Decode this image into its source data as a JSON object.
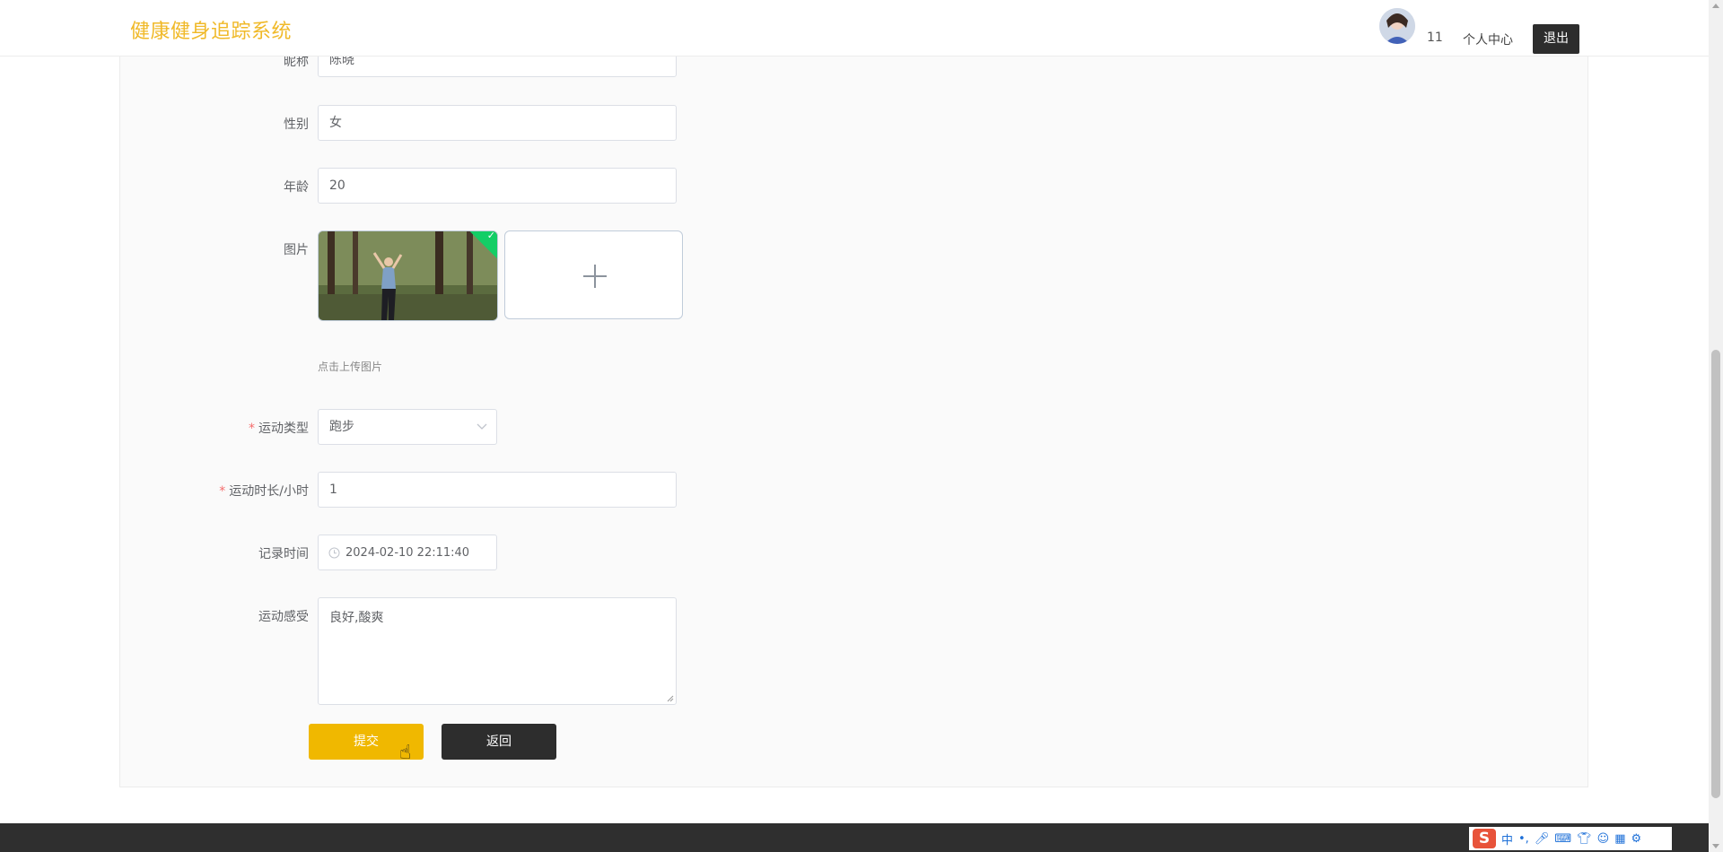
{
  "header": {
    "brand": "健康健身追踪系统",
    "username": "11",
    "personal_center": "个人中心",
    "logout": "退出"
  },
  "form": {
    "nickname": {
      "label": "昵称",
      "value": "陈晓"
    },
    "gender": {
      "label": "性别",
      "value": "女"
    },
    "age": {
      "label": "年龄",
      "value": "20"
    },
    "image": {
      "label": "图片",
      "hint": "点击上传图片"
    },
    "sport_type": {
      "label": "运动类型",
      "value": "跑步"
    },
    "duration": {
      "label": "运动时长/小时",
      "value": "1"
    },
    "record_time": {
      "label": "记录时间",
      "value": "2024-02-10 22:11:40"
    },
    "feeling": {
      "label": "运动感受",
      "value": "良好,酸爽"
    }
  },
  "buttons": {
    "submit": "提交",
    "back": "返回"
  },
  "ime": {
    "logo": "S",
    "mode": "中",
    "punct": "•,"
  },
  "colors": {
    "brand": "#f0b928",
    "submit_bg": "#f0b800",
    "back_bg": "#2d2d2d",
    "upload_ok": "#13ce66",
    "required_star": "#f56c6c"
  },
  "icons": [
    "clock-icon",
    "chevron-down-icon",
    "plus-icon",
    "check-icon",
    "pointer-hand-icon",
    "microphone-icon",
    "keyboard-icon",
    "shirt-icon",
    "grid-icon",
    "gear-icon"
  ]
}
